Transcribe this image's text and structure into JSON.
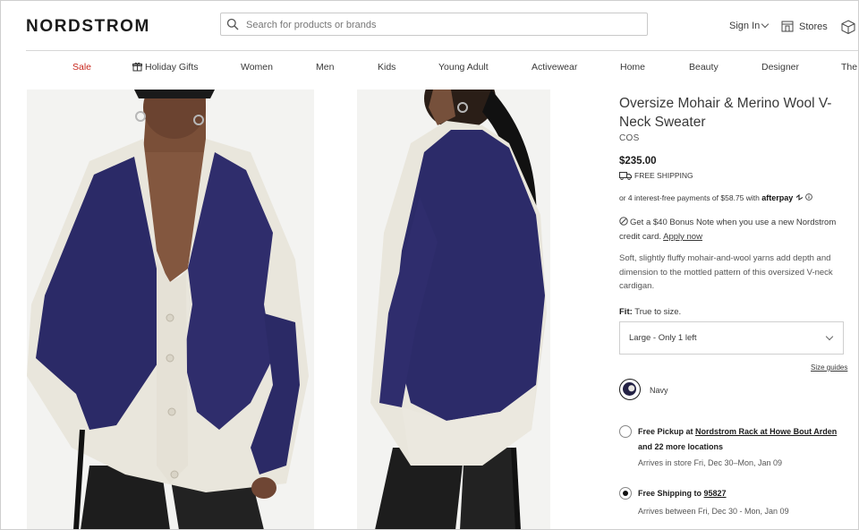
{
  "header": {
    "logo": "NORDSTROM",
    "search_placeholder": "Search for products or brands",
    "sign_in": "Sign In",
    "stores": "Stores"
  },
  "nav": {
    "items": [
      "Sale",
      "Holiday Gifts",
      "Women",
      "Men",
      "Kids",
      "Young Adult",
      "Activewear",
      "Home",
      "Beauty",
      "Designer",
      "The"
    ]
  },
  "product": {
    "title": "Oversize Mohair & Merino Wool V-Neck Sweater",
    "brand": "COS",
    "price": "$235.00",
    "free_shipping": "FREE SHIPPING",
    "afterpay_text": "or 4 interest-free payments of $58.75 with",
    "afterpay_brand": "afterpay",
    "bonus_text": "Get a $40 Bonus Note when you use a new Nordstrom credit card.",
    "apply_now": "Apply now",
    "description": "Soft, slightly fluffy mohair-and-wool yarns add depth and dimension to the mottled pattern of this oversized V-neck cardigan.",
    "fit_label": "Fit:",
    "fit_value": "True to size.",
    "size_selected": "Large - Only 1 left",
    "size_guides": "Size guides",
    "color": "Navy"
  },
  "fulfillment": {
    "pickup_prefix": "Free Pickup at",
    "pickup_store": "Nordstrom Rack at Howe Bout Arden",
    "pickup_more": "and 22 more locations",
    "pickup_arrival": "Arrives in store Fri, Dec 30–Mon, Jan 09",
    "pickup_selected": false,
    "ship_prefix": "Free Shipping to",
    "ship_zip": "95827",
    "ship_arrival": "Arrives between Fri, Dec 30 - Mon, Jan 09",
    "ship_selected": true
  },
  "colors": {
    "sale": "#c8281e",
    "swatch_navy": "#232144"
  }
}
